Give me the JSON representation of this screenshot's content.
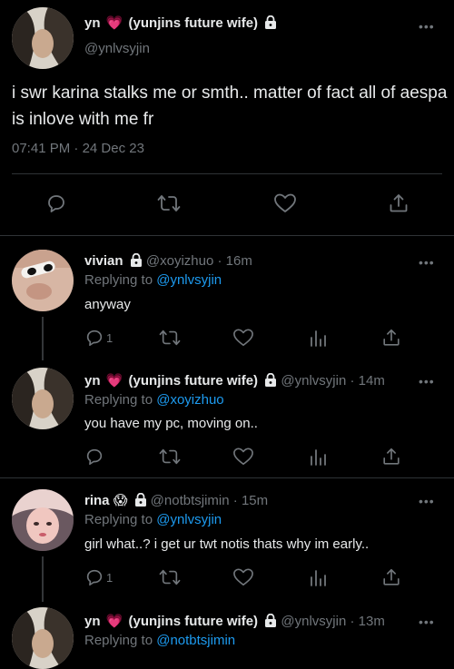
{
  "main_tweet": {
    "display_name": "yn",
    "name_suffix": "(yunjins future wife)",
    "handle": "@ynlvsyjin",
    "text": "i swr karina stalks me or smth.. matter of fact all of aespa is inlove with me fr",
    "time": "07:41 PM",
    "date": "24 Dec 23",
    "more": "•••"
  },
  "replies": [
    {
      "display_name": "vivian",
      "handle": "@xoyizhuo",
      "age": "16m",
      "replying_label": "Replying to",
      "replying_to": "@ynlvsyjin",
      "text": "anyway",
      "reply_count": "1",
      "more": "•••"
    },
    {
      "display_name": "yn",
      "name_suffix": "(yunjins future wife)",
      "handle": "@ynlvsyjin",
      "age": "14m",
      "replying_label": "Replying to",
      "replying_to": "@xoyizhuo",
      "text": "you have my pc, moving on..",
      "reply_count": "",
      "more": "•••"
    },
    {
      "display_name": "rina",
      "handle": "@notbtsjimin",
      "age": "15m",
      "replying_label": "Replying to",
      "replying_to": "@ynlvsyjin",
      "text": "girl what..? i get ur twt notis thats why im early..",
      "reply_count": "1",
      "more": "•••"
    },
    {
      "display_name": "yn",
      "name_suffix": "(yunjins future wife)",
      "handle": "@ynlvsyjin",
      "age": "13m",
      "replying_label": "Replying to",
      "replying_to": "@notbtsjimin",
      "more": "•••"
    }
  ],
  "separator": "·",
  "colors": {
    "background": "#000000",
    "text": "#e7e9ea",
    "secondary": "#71767b",
    "link": "#1d9bf0",
    "divider": "#2f3336",
    "heart_emoji": "#ff3d8b"
  },
  "icons": [
    "reply-icon",
    "retweet-icon",
    "like-icon",
    "share-icon",
    "views-icon",
    "lock-icon",
    "heart-emoji-icon",
    "scream-emoji-icon",
    "more-icon"
  ]
}
